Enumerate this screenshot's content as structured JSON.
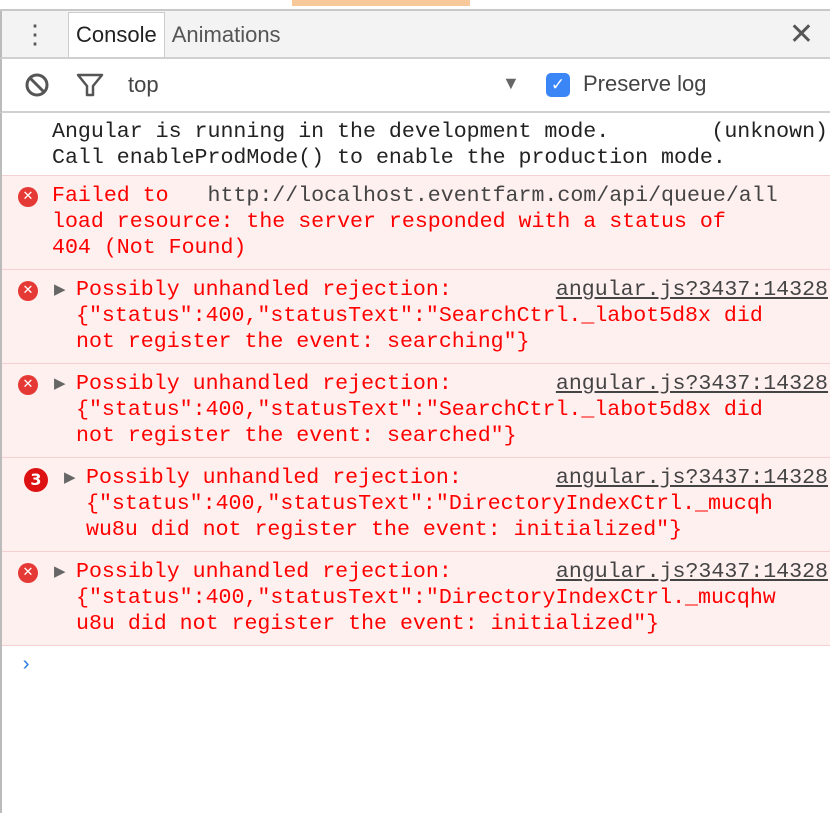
{
  "tabs": {
    "console": "Console",
    "animations": "Animations"
  },
  "toolbar": {
    "context": "top",
    "preserve_log": "Preserve log",
    "preserve_checked": true
  },
  "messages": [
    {
      "type": "log",
      "text": "Angular is running in the development mode.\nCall enableProdMode() to enable the production mode.",
      "source": "(unknown)"
    },
    {
      "type": "error",
      "prefix": "Failed to ",
      "url": "http://localhost.eventfarm.com/api/queue/all",
      "text": "load resource: the server responded with a status of\n404 (Not Found)"
    },
    {
      "type": "error",
      "text": "Possibly unhandled rejection:\n{\"status\":400,\"statusText\":\"SearchCtrl._labot5d8x did\nnot register the event: searching\"}",
      "source": "angular.js?3437:14328"
    },
    {
      "type": "error",
      "text": "Possibly unhandled rejection:\n{\"status\":400,\"statusText\":\"SearchCtrl._labot5d8x did\nnot register the event: searched\"}",
      "source": "angular.js?3437:14328"
    },
    {
      "type": "error",
      "count": "3",
      "text": "Possibly unhandled rejection:\n{\"status\":400,\"statusText\":\"DirectoryIndexCtrl._mucqh\nwu8u did not register the event: initialized\"}",
      "source": "angular.js?3437:14328"
    },
    {
      "type": "error",
      "text": "Possibly unhandled rejection:\n{\"status\":400,\"statusText\":\"DirectoryIndexCtrl._mucqhw\nu8u did not register the event: initialized\"}",
      "source": "angular.js?3437:14328"
    }
  ],
  "prompt": "›"
}
